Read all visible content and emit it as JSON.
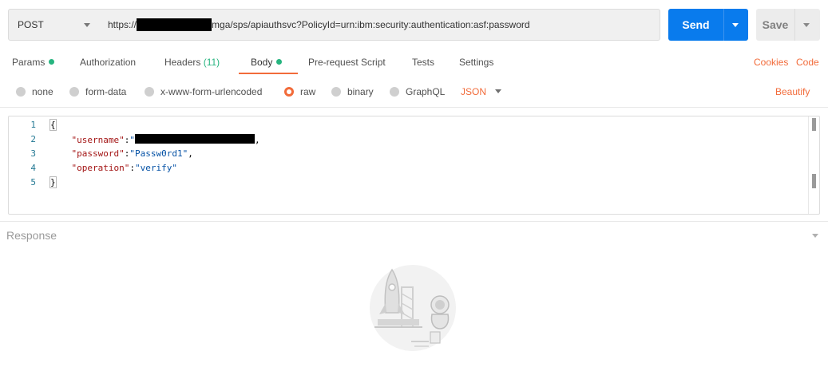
{
  "request": {
    "method": "POST",
    "url_prefix": "https://",
    "url_suffix": "mga/sps/apiauthsvc?PolicyId=urn:ibm:security:authentication:asf:password",
    "send_label": "Send",
    "save_label": "Save"
  },
  "tabs": [
    {
      "label": "Params"
    },
    {
      "label": "Authorization"
    },
    {
      "label": "Headers",
      "count": "(11)"
    },
    {
      "label": "Body"
    },
    {
      "label": "Pre-request Script"
    },
    {
      "label": "Tests"
    },
    {
      "label": "Settings"
    }
  ],
  "links": {
    "cookies": "Cookies",
    "code": "Code",
    "beautify": "Beautify"
  },
  "body_types": [
    "none",
    "form-data",
    "x-www-form-urlencoded",
    "raw",
    "binary",
    "GraphQL"
  ],
  "body_type_selected": "raw",
  "format": "JSON",
  "editor": {
    "line_numbers": [
      "1",
      "2",
      "3",
      "4",
      "5"
    ],
    "open_brace": "{",
    "close_brace": "}",
    "username_key": "\"username\"",
    "password_key": "\"password\"",
    "password_value": "\"Passw0rd1\"",
    "operation_key": "\"operation\"",
    "operation_value": "\"verify\""
  },
  "response": {
    "label": "Response"
  },
  "colors": {
    "accent": "#f26b3a",
    "primary": "#097bed",
    "success": "#26b47f"
  }
}
